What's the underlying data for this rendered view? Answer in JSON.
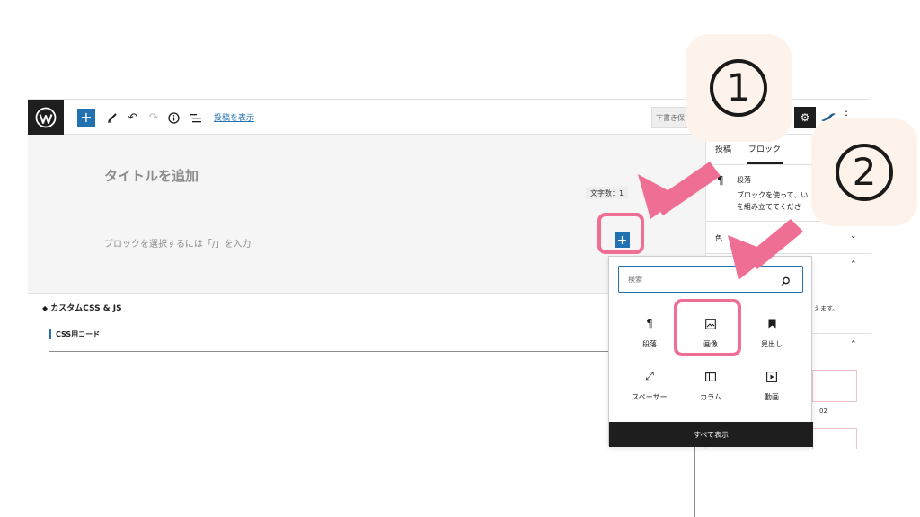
{
  "toolbar": {
    "view_post_link": "投稿を表示",
    "draft_button": "下書き保",
    "more_label": "⋮"
  },
  "editor": {
    "title_placeholder": "タイトルを追加",
    "word_count": "文字数：1",
    "block_placeholder": "ブロックを選択するには「/」を入力"
  },
  "meta_box": {
    "title": "カスタムCSS & JS",
    "css_label": "CSS用コード"
  },
  "sidebar": {
    "tabs": [
      "投稿",
      "ブロック"
    ],
    "active_tab": "ブロック",
    "block_name": "段落",
    "block_description": [
      "ブロックを使って、い",
      "を組み立ててくださ"
    ],
    "panels": [
      "色"
    ],
    "partial_text": "えます。",
    "swatch_label": "02"
  },
  "inserter": {
    "search_placeholder": "検索",
    "blocks": [
      {
        "label": "段落",
        "icon": "paragraph-icon"
      },
      {
        "label": "画像",
        "icon": "image-icon"
      },
      {
        "label": "見出し",
        "icon": "bookmark-icon"
      },
      {
        "label": "スペーサー",
        "icon": "expand-icon"
      },
      {
        "label": "カラム",
        "icon": "columns-icon"
      },
      {
        "label": "動画",
        "icon": "video-icon"
      }
    ],
    "browse_all": "すべて表示"
  },
  "callouts": [
    "1",
    "2"
  ],
  "colors": {
    "accent": "#2271b1",
    "highlight": "#ef6f94",
    "callout_bg": "#fdf3ea",
    "dark": "#1e1e1e"
  }
}
